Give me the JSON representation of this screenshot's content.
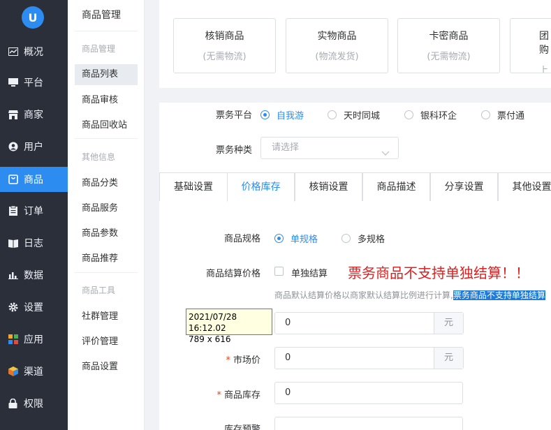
{
  "nav": {
    "logo_text": "U",
    "items": [
      {
        "label": "概况",
        "icon": "chart-icon"
      },
      {
        "label": "平台",
        "icon": "monitor-icon"
      },
      {
        "label": "商家",
        "icon": "store-icon"
      },
      {
        "label": "用户",
        "icon": "user-icon"
      },
      {
        "label": "商品",
        "icon": "bag-icon"
      },
      {
        "label": "订单",
        "icon": "clipboard-icon"
      },
      {
        "label": "日志",
        "icon": "book-icon"
      },
      {
        "label": "数据",
        "icon": "bar-chart-icon"
      },
      {
        "label": "设置",
        "icon": "gear-icon"
      },
      {
        "label": "应用",
        "icon": "apps-icon"
      },
      {
        "label": "渠道",
        "icon": "cube-icon"
      },
      {
        "label": "权限",
        "icon": "lock-icon"
      }
    ],
    "active_index": 4
  },
  "submenu": {
    "title": "商品管理",
    "groups": [
      {
        "label": "商品管理",
        "items": [
          "商品列表",
          "商品审核",
          "商品回收站"
        ]
      },
      {
        "label": "其他信息",
        "items": [
          "商品分类",
          "商品服务",
          "商品参数",
          "商品推荐"
        ]
      },
      {
        "label": "商品工具",
        "items": [
          "社群管理",
          "评价管理",
          "商品设置"
        ]
      }
    ],
    "active_item": "商品列表"
  },
  "product_types": [
    {
      "title": "核销商品",
      "sub": "(无需物流)"
    },
    {
      "title": "实物商品",
      "sub": "(物流发货)"
    },
    {
      "title": "卡密商品",
      "sub": "(无需物流)"
    },
    {
      "title": "团购",
      "sub": "上门"
    }
  ],
  "form": {
    "ticket_platform_label": "票务平台",
    "ticket_platforms": [
      "自我游",
      "天时同城",
      "银科环企",
      "票付通"
    ],
    "ticket_platform_selected": 0,
    "ticket_type_label": "票务种类",
    "ticket_type_placeholder": "请选择",
    "tabs": [
      "基础设置",
      "价格库存",
      "核销设置",
      "商品描述",
      "分享设置",
      "其他设置"
    ],
    "active_tab": 1,
    "spec_label": "商品规格",
    "spec_options": [
      "单规格",
      "多规格"
    ],
    "spec_selected": 0,
    "settle_label": "商品结算价格",
    "settle_checkbox_label": "单独结算",
    "settle_warning": "票务商品不支持单独结算！！",
    "settle_hint": "商品默认结算价格以商家默认结算比例进行计算,",
    "settle_hint_highlight": "票务商品不支持单独结算",
    "price_value": "0",
    "price_unit": "元",
    "market_price_label": "市场价",
    "market_price_value": "0",
    "market_price_unit": "元",
    "stock_label": "商品库存",
    "stock_value": "0",
    "stock_warning_label": "库存预警",
    "required_mark": "*"
  },
  "tooltip": {
    "timestamp": "2021/07/28 16:12.02",
    "size": "789 x 616"
  }
}
